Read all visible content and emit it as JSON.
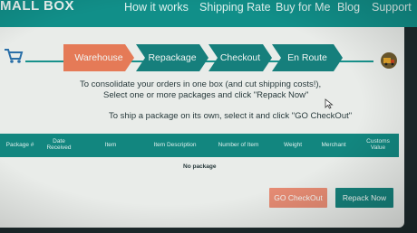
{
  "nav": {
    "logo": "MALL BOX",
    "items": [
      "How it works",
      "Shipping Rate",
      "Buy for Me",
      "Blog",
      "Support"
    ]
  },
  "icons": {
    "left": "shopping-cart-icon",
    "right": "delivery-truck-icon"
  },
  "steps": [
    "Warehouse",
    "Repackage",
    "Checkout",
    "En Route"
  ],
  "instructions": {
    "line1": "To consolidate your orders in one box (and cut shipping costs!),",
    "line2": "Select one or more packages and click \"Repack Now\"",
    "line3": "To ship a package on its own, select it and click \"GO CheckOut\""
  },
  "table": {
    "columns": [
      "Package #",
      "Date Received",
      "Item",
      "Item Description",
      "Number of Item",
      "Weight",
      "Merchant",
      "Customs Value"
    ],
    "empty_text": "No package"
  },
  "buttons": {
    "checkout": "GO CheckOut",
    "repack": "Repack Now"
  },
  "colors": {
    "accent": "#118f89",
    "step_active": "#e57a57",
    "checkout_button": "#e58b73"
  }
}
